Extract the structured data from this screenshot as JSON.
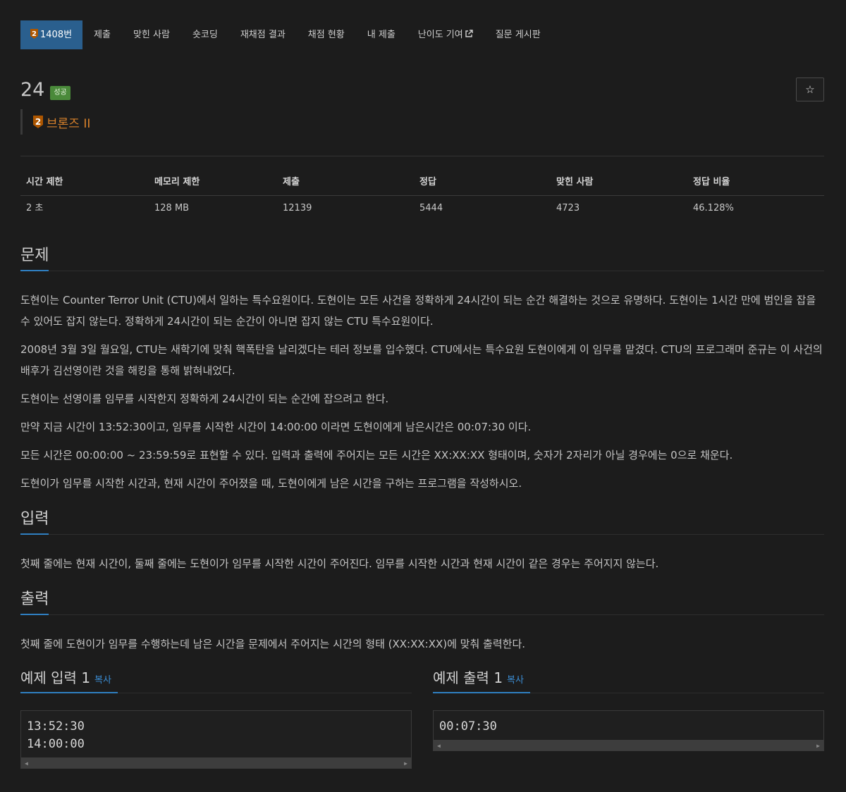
{
  "tabs": [
    {
      "label": "1408번",
      "active": true
    },
    {
      "label": "제출"
    },
    {
      "label": "맞힌 사람"
    },
    {
      "label": "숏코딩"
    },
    {
      "label": "재채점 결과"
    },
    {
      "label": "채점 현황"
    },
    {
      "label": "내 제출"
    },
    {
      "label": "난이도 기여"
    },
    {
      "label": "질문 게시판"
    }
  ],
  "problem": {
    "title": "24",
    "status": "성공",
    "tier_number": "2",
    "tier_name": "브론즈 II",
    "star": "☆"
  },
  "info": {
    "headers": [
      "시간 제한",
      "메모리 제한",
      "제출",
      "정답",
      "맞힌 사람",
      "정답 비율"
    ],
    "values": [
      "2 초",
      "128 MB",
      "12139",
      "5444",
      "4723",
      "46.128%"
    ]
  },
  "sections": {
    "problem_heading": "문제",
    "problem_paras": [
      "도현이는 Counter Terror Unit (CTU)에서 일하는 특수요원이다. 도현이는 모든 사건을 정확하게 24시간이 되는 순간 해결하는 것으로 유명하다. 도현이는 1시간 만에 범인을 잡을 수 있어도 잡지 않는다. 정확하게 24시간이 되는 순간이 아니면 잡지 않는 CTU 특수요원이다.",
      "2008년 3월 3일 월요일, CTU는 새학기에 맞춰 핵폭탄을 날리겠다는 테러 정보를 입수했다. CTU에서는 특수요원 도현이에게 이 임무를 맡겼다. CTU의 프로그래머 준규는 이 사건의 배후가 김선영이란 것을 해킹을 통해 밝혀내었다.",
      "도현이는 선영이를 임무를 시작한지 정확하게 24시간이 되는 순간에 잡으려고 한다.",
      "만약 지금 시간이 13:52:30이고, 임무를 시작한 시간이 14:00:00 이라면 도현이에게 남은시간은 00:07:30 이다.",
      "모든 시간은 00:00:00 ~ 23:59:59로 표현할 수 있다. 입력과 출력에 주어지는 모든 시간은 XX:XX:XX 형태이며, 숫자가 2자리가 아닐 경우에는 0으로 채운다.",
      "도현이가 임무를 시작한 시간과, 현재 시간이 주어졌을 때, 도현이에게 남은 시간을 구하는 프로그램을 작성하시오."
    ],
    "input_heading": "입력",
    "input_text": "첫째 줄에는 현재 시간이, 둘째 줄에는 도현이가 임무를 시작한 시간이 주어진다. 임무를 시작한 시간과 현재 시간이 같은 경우는 주어지지 않는다.",
    "output_heading": "출력",
    "output_text": "첫째 줄에 도현이가 임무를 수행하는데 남은 시간을 문제에서 주어지는 시간의 형태 (XX:XX:XX)에 맞춰 출력한다."
  },
  "samples": {
    "input_heading": "예제 입력 1",
    "output_heading": "예제 출력 1",
    "copy_label": "복사",
    "input_lines": [
      "13:52:30",
      "14:00:00"
    ],
    "output_lines": [
      "00:07:30"
    ]
  },
  "colors": {
    "active_tab": "#2a5f8e",
    "success_badge": "#4a8a3a",
    "bronze": "#d9822b",
    "accent_blue": "#2f7fc1"
  }
}
